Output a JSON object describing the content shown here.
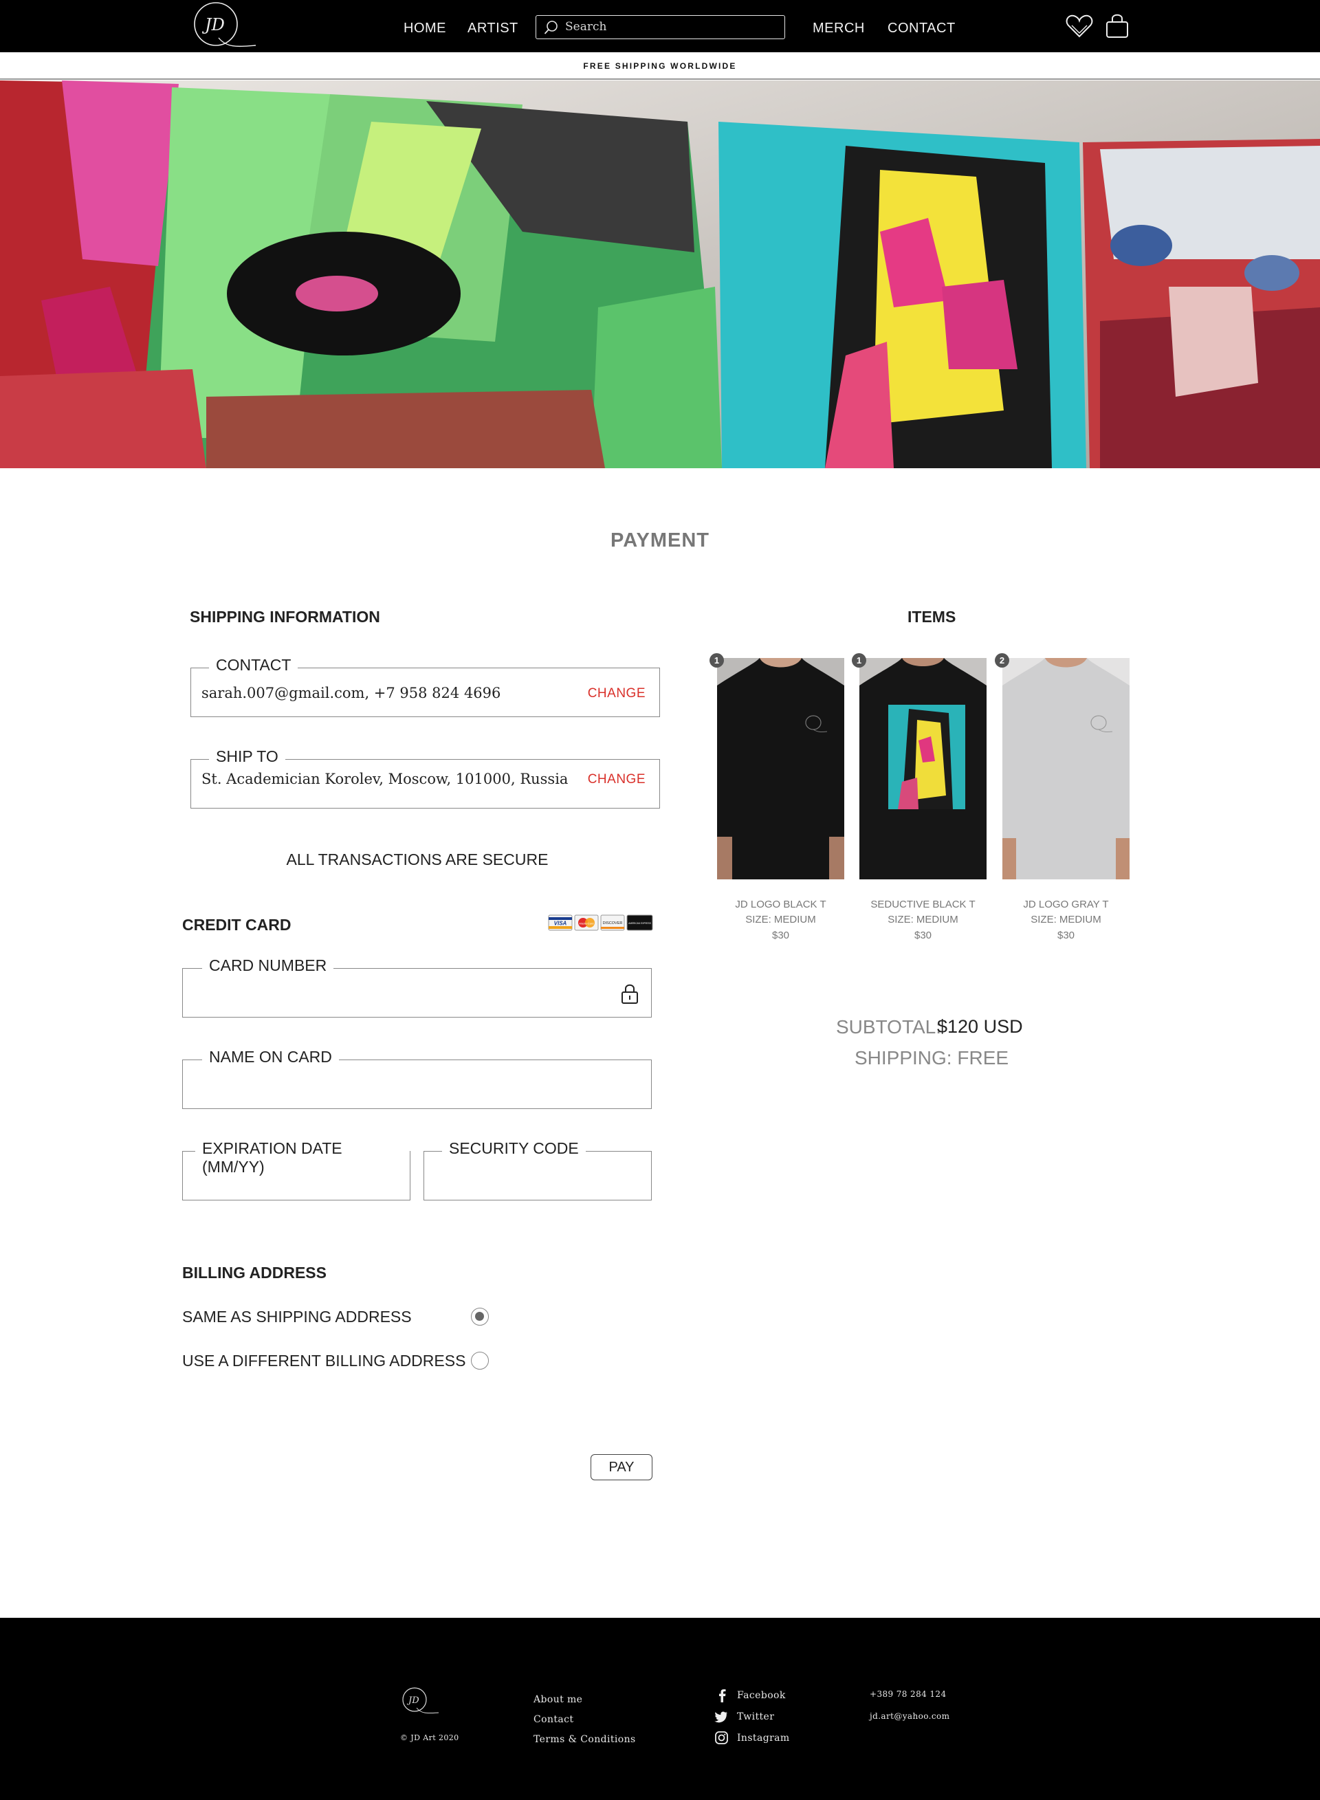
{
  "header": {
    "nav": {
      "home": "HOME",
      "artist": "ARTIST",
      "merch": "MERCH",
      "contact": "CONTACT"
    },
    "search_placeholder": "Search",
    "banner": "FREE SHIPPING WORLDWIDE"
  },
  "page": {
    "title": "PAYMENT"
  },
  "shipping": {
    "heading": "SHIPPING INFORMATION",
    "contact_legend": "CONTACT",
    "contact_value": "sarah.007@gmail.com,   +7 958 824 4696",
    "ship_to_legend": "SHIP TO",
    "ship_to_value": "St. Academician Korolev, Moscow, 101000, Russia",
    "change_label": "CHANGE"
  },
  "payment": {
    "secure_note": "ALL TRANSACTIONS ARE SECURE",
    "credit_card_heading": "CREDIT CARD",
    "card_brands": [
      "VISA",
      "MasterCard",
      "DISCOVER",
      "AMERICAN EXPRESS"
    ],
    "card_number_label": "CARD NUMBER",
    "name_on_card_label": "NAME ON CARD",
    "expiration_label": "EXPIRATION DATE (MM/YY)",
    "security_code_label": "SECURITY CODE"
  },
  "billing": {
    "heading": "BILLING ADDRESS",
    "options": [
      {
        "label": "SAME AS SHIPPING ADDRESS",
        "selected": true
      },
      {
        "label": "USE A DIFFERENT BILLING ADDRESS",
        "selected": false
      }
    ]
  },
  "pay_button": "PAY",
  "items": {
    "heading": "ITEMS",
    "list": [
      {
        "qty": "1",
        "name": "JD LOGO BLACK T",
        "size": "SIZE: MEDIUM",
        "price": "$30"
      },
      {
        "qty": "1",
        "name": "SEDUCTIVE BLACK T",
        "size": "SIZE: MEDIUM",
        "price": "$30"
      },
      {
        "qty": "2",
        "name": "JD LOGO GRAY T",
        "size": "SIZE: MEDIUM",
        "price": "$30"
      }
    ]
  },
  "totals": {
    "subtotal_label": "SUBTOTAL:",
    "subtotal_value": "$120 USD",
    "shipping": "SHIPPING: FREE"
  },
  "footer": {
    "copyright": "© JD Art 2020",
    "links": [
      "About me",
      "Contact",
      "Terms & Conditions"
    ],
    "social": [
      "Facebook",
      "Twitter",
      "Instagram"
    ],
    "phone": "+389 78 284 124",
    "email": "jd.art@yahoo.com"
  },
  "colors": {
    "nav_bg": "#000000",
    "accent_red": "#d9302a",
    "muted_text": "#777777"
  }
}
